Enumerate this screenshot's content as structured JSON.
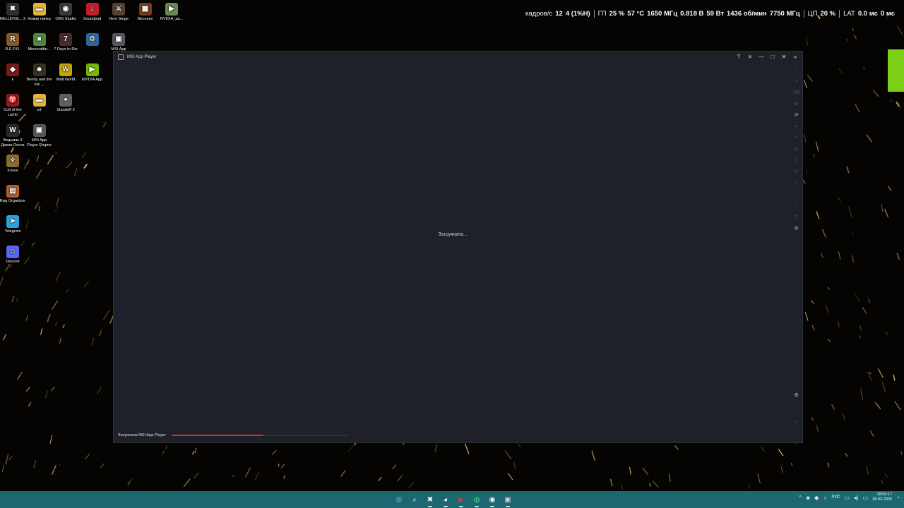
{
  "desktop": {
    "icons": [
      {
        "label": "HELLDIVE... 2",
        "glyph": "✖",
        "color": "#303030"
      },
      {
        "label": "Новая папка",
        "glyph": "▬",
        "color": "#e4b43c"
      },
      {
        "label": "OBS Studio",
        "glyph": "◉",
        "color": "#3a3a3a"
      },
      {
        "label": "Soundpad",
        "glyph": "♪",
        "color": "#c0202a"
      },
      {
        "label": "Hero Siege",
        "glyph": "⚔",
        "color": "#5a4030"
      },
      {
        "label": "Necesse",
        "glyph": "▦",
        "color": "#7a3a20"
      },
      {
        "label": "NVIDIA_ap...",
        "glyph": "▶",
        "color": "#6a8a50"
      },
      {
        "label": "R.E.P.O.",
        "glyph": "R",
        "color": "#8a5a20"
      },
      {
        "label": "Minecraftin...",
        "glyph": "■",
        "color": "#4c8a3a"
      },
      {
        "label": "7 Days to Die",
        "glyph": "7",
        "color": "#4a2a2a"
      },
      {
        "label": "",
        "glyph": "♲",
        "color": "#2a6aa0"
      },
      {
        "label": "MSI App",
        "glyph": "▣",
        "color": "#555a60"
      },
      {
        "label": "к",
        "glyph": "◆",
        "color": "#7a1a1a"
      },
      {
        "label": "Bendy and the Ink ...",
        "glyph": "☻",
        "color": "#3a3020"
      },
      {
        "label": "Wall World",
        "glyph": "W",
        "color": "#c8a800"
      },
      {
        "label": "NVIDIA App",
        "glyph": "▶",
        "color": "#76b900"
      },
      {
        "label": "Cult of the Lamb",
        "glyph": "♈",
        "color": "#902020"
      },
      {
        "label": "zd",
        "glyph": "▬",
        "color": "#e4b43c"
      },
      {
        "label": "Standoff 2",
        "glyph": "⌖",
        "color": "#606060"
      },
      {
        "label": "Ведьмак 3 Дикая Охота",
        "glyph": "W",
        "color": "#2a2a2a"
      },
      {
        "label": "MSI App Player Engine",
        "glyph": "▣",
        "color": "#555a60"
      },
      {
        "label": "Icarus",
        "glyph": "✧",
        "color": "#8a6a30"
      },
      {
        "label": "Rag Organizer",
        "glyph": "▤",
        "color": "#b06030"
      },
      {
        "label": "Telegram",
        "glyph": "➤",
        "color": "#2aa3dc"
      },
      {
        "label": "Discord",
        "glyph": "☺",
        "color": "#5865f2"
      }
    ]
  },
  "osd": {
    "fps_label": "кадров/с",
    "fps_value": "12",
    "frametime": "4 (1%Н)",
    "gpu_label": "ГП",
    "gpu_load": "25 %",
    "gpu_temp": "57 °С",
    "gpu_clock": "1650 МГц",
    "gpu_voltage": "0.818 В",
    "gpu_power": "59 Вт",
    "fan": "1436 об/мин",
    "mem_clock": "7750 МГц",
    "cpu_label": "ЦП",
    "cpu_load": "20 %",
    "lat_label": "LAT",
    "lat_1": "0.0 мс",
    "lat_2": "0 мс"
  },
  "window": {
    "title": "MSI App Player",
    "loading_text": "Загружаем...",
    "status_text": "Запускаем MSI App Player",
    "progress": 0.52,
    "controls": {
      "help": "?",
      "menu": "≡",
      "minimize": "—",
      "maximize": "□",
      "close": "✕",
      "collapse": "«"
    }
  },
  "taskbar": {
    "apps": [
      {
        "name": "start",
        "glyph": "⊞",
        "color": "#4cc2ff"
      },
      {
        "name": "search",
        "glyph": "⌕",
        "color": "#dfeff2"
      },
      {
        "name": "epic",
        "glyph": "✖",
        "color": "#ffffff"
      },
      {
        "name": "steam",
        "glyph": "◕",
        "color": "#ffffff"
      },
      {
        "name": "media",
        "glyph": "▶",
        "color": "#e0304a"
      },
      {
        "name": "browser",
        "glyph": "◍",
        "color": "#3ddc84"
      },
      {
        "name": "obs",
        "glyph": "◉",
        "color": "#ffffff"
      },
      {
        "name": "msi-app-player",
        "glyph": "▣",
        "color": "#d0d4d8"
      }
    ],
    "lang": "РУС",
    "time": "18:50:17",
    "date": "28.02.2026"
  },
  "colors": {
    "accent_progress": "#e0243f",
    "taskbar": "#1c6770",
    "window_bg": "#1e212a"
  }
}
